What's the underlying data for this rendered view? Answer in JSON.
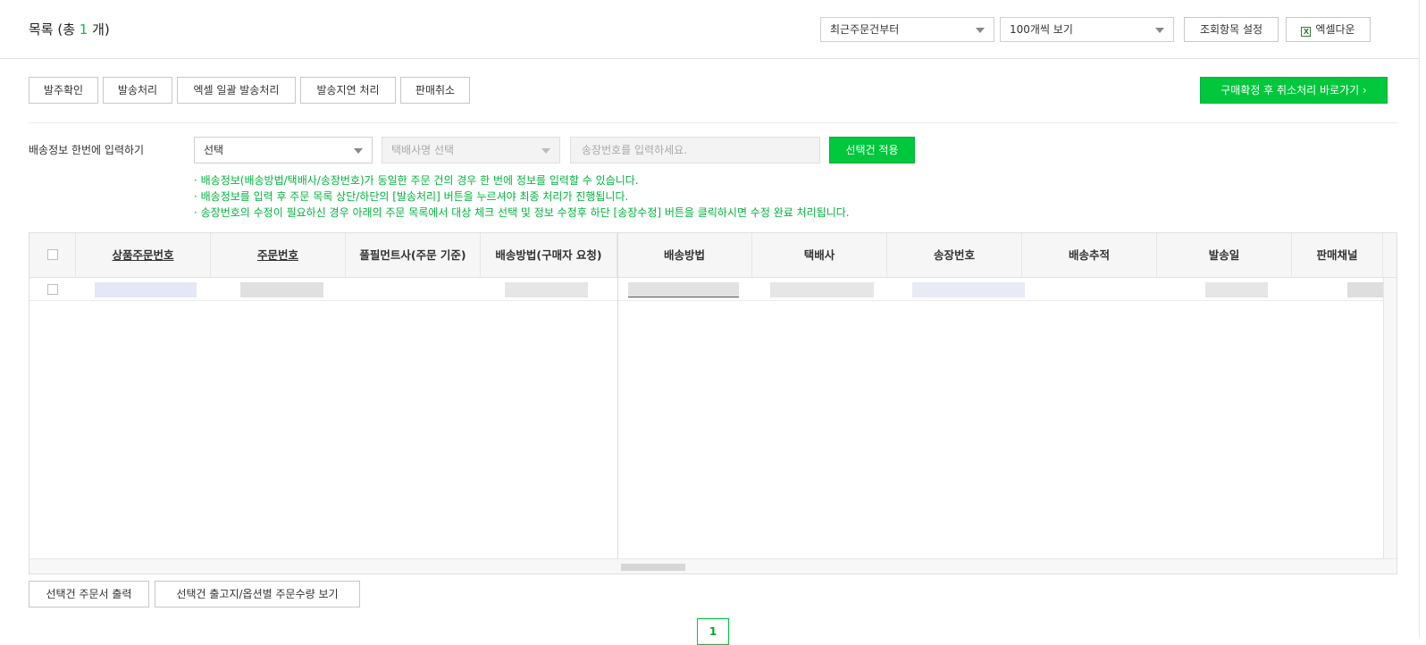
{
  "header": {
    "title_prefix": "목록 (총 ",
    "count": "1",
    "title_suffix": " 개)",
    "sort_select": "최근주문건부터",
    "page_size_select": "100개씩 보기",
    "column_settings": "조회항목 설정",
    "excel_download": "엑셀다운",
    "excel_icon": "X"
  },
  "actions": {
    "confirm_order": "발주확인",
    "dispatch": "발송처리",
    "excel_bulk_dispatch": "엑셀 일괄 발송처리",
    "delayed_dispatch": "발송지연 처리",
    "cancel_sale": "판매취소",
    "go_cancel": "구매확정 후 취소처리 바로가기 ›"
  },
  "bulk": {
    "label": "배송정보 한번에 입력하기",
    "method_select": "선택",
    "courier_select": "택배사명 선택",
    "tracking_placeholder": "송장번호를 입력하세요.",
    "apply": "선택건 적용",
    "notes": [
      "· 배송정보(배송방법/택배사/송장번호)가 동일한 주문 건의 경우 한 번에 정보를 입력할 수 있습니다.",
      "· 배송정보를 입력 후 주문 목록 상단/하단의 [발송처리] 버튼을 누르셔야 최종 처리가 진행됩니다.",
      "· 송장번호의 수정이 필요하신 경우 아래의 주문 목록에서 대상 체크 선택 및 정보 수정후 하단 [송장수정] 버튼을 클릭하시면 수정 완료 처리됩니다."
    ]
  },
  "table": {
    "columns": [
      "상품주문번호",
      "주문번호",
      "풀필먼트사(주문 기준)",
      "배송방법(구매자 요청)",
      "배송방법",
      "택배사",
      "송장번호",
      "배송추적",
      "발송일",
      "판매채널"
    ]
  },
  "footer": {
    "print_orders": "선택건 주문서 출력",
    "view_quantity": "선택건 출고지/옵션별 주문수량 보기",
    "page": "1"
  },
  "colors": {
    "accent": "#00c73c",
    "note_text": "#00b33c"
  }
}
